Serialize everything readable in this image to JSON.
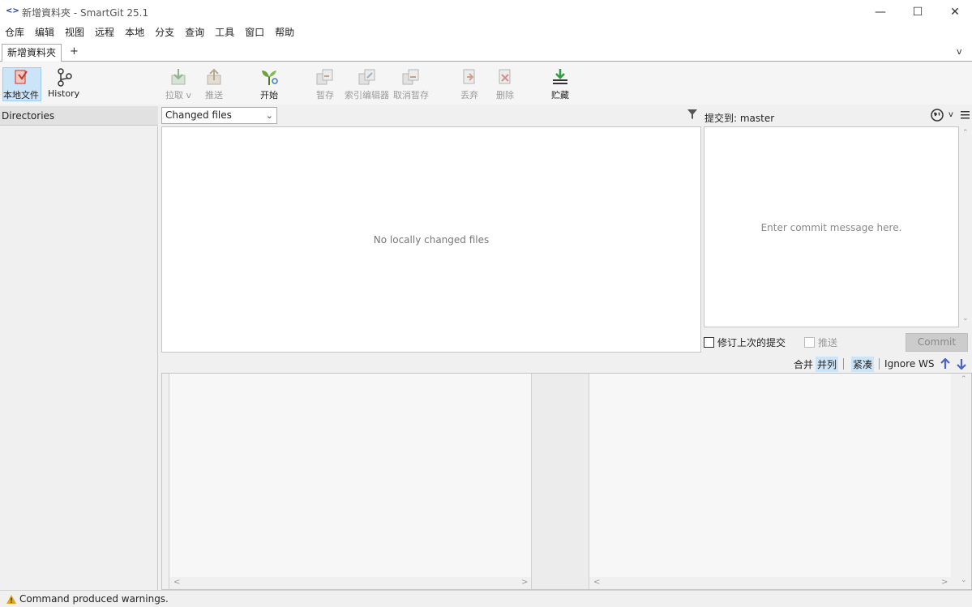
{
  "window": {
    "title": "新增資料夾 - SmartGit 25.1",
    "logo": "<>"
  },
  "menu": [
    "仓库",
    "编辑",
    "视图",
    "远程",
    "本地",
    "分支",
    "查询",
    "工具",
    "窗口",
    "帮助"
  ],
  "tabs": {
    "active": "新增資料夾",
    "add": "+",
    "overflow": "v"
  },
  "toolbar": {
    "local_files": "本地文件",
    "history": "History",
    "pull": "拉取 v",
    "push": "推送",
    "start": "开始",
    "stash": "暂存",
    "index_editor": "索引编辑器",
    "unstage": "取消暂存",
    "discard": "丢弃",
    "delete": "删除",
    "stash_save": "贮藏"
  },
  "left_panel": {
    "header": "Directories"
  },
  "files": {
    "view_select": "Changed files",
    "empty_text": "No locally changed files"
  },
  "commit": {
    "commit_to_label": "提交到: master",
    "placeholder": "Enter commit message here.",
    "amend_label": "修订上次的提交",
    "push_label": "推送",
    "commit_button": "Commit"
  },
  "diff_toolbar": {
    "merge": "合并",
    "side_by_side": "并列",
    "compact": "紧凑",
    "ignore_ws": "Ignore WS"
  },
  "status": {
    "message": "Command produced warnings."
  },
  "colors": {
    "accent": "#cce4f7",
    "warning": "#e8a317",
    "green": "#2e9e3e",
    "blue_arrow": "#4a63c9"
  }
}
